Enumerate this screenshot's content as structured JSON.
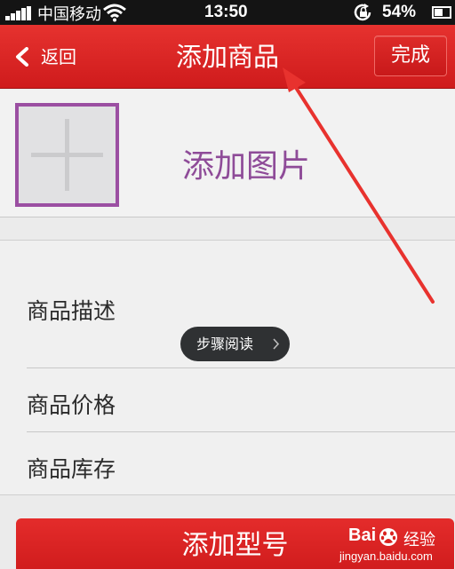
{
  "status_bar": {
    "carrier": "中国移动",
    "time": "13:50",
    "battery": "54%",
    "battery_level": 0.54,
    "signal_bars": 5
  },
  "nav": {
    "back_label": "返回",
    "title": "添加商品",
    "done_label": "完成"
  },
  "image_section": {
    "add_image_label": "添加图片"
  },
  "form": {
    "rows": [
      {
        "label": "商品描述"
      },
      {
        "label": "商品价格"
      },
      {
        "label": "商品库存"
      }
    ]
  },
  "overlay": {
    "step_read_label": "步骤阅读"
  },
  "actions": {
    "add_model_label": "添加型号"
  },
  "watermark": {
    "brand": "Bai",
    "jingyan": "经验",
    "url": "jingyan.baidu.com"
  },
  "colors": {
    "nav_red": "#d9221f",
    "image_frame_purple": "#9b4fa2",
    "annotation_red": "#e8322e"
  },
  "icons": {
    "back": "chevron-left-icon",
    "plus": "plus-icon",
    "wifi": "wifi-icon",
    "lock": "rotation-lock-icon",
    "pill_arrow": "chevron-right-icon",
    "watermark": "baidu-paw-icon"
  }
}
